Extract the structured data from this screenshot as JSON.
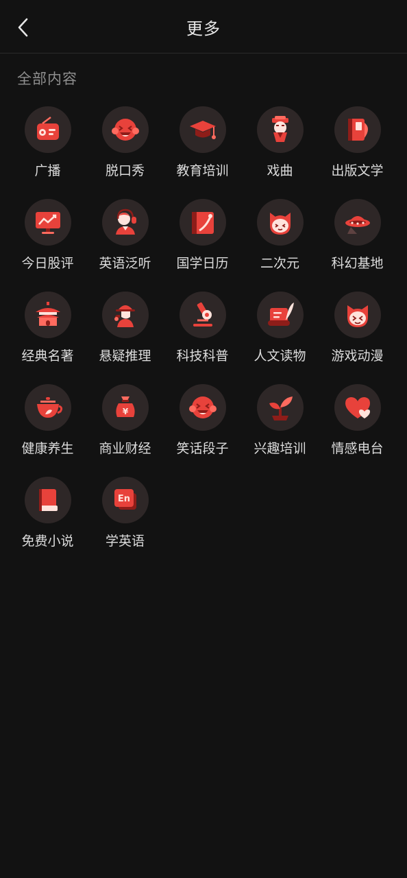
{
  "header": {
    "title": "更多"
  },
  "section": {
    "title": "全部内容"
  },
  "items": [
    {
      "label": "广播",
      "icon": "radio"
    },
    {
      "label": "脱口秀",
      "icon": "laugh"
    },
    {
      "label": "教育培训",
      "icon": "grad-cap"
    },
    {
      "label": "戏曲",
      "icon": "opera"
    },
    {
      "label": "出版文学",
      "icon": "book"
    },
    {
      "label": "今日股评",
      "icon": "chart"
    },
    {
      "label": "英语泛听",
      "icon": "headset"
    },
    {
      "label": "国学日历",
      "icon": "calendar"
    },
    {
      "label": "二次元",
      "icon": "anime"
    },
    {
      "label": "科幻基地",
      "icon": "ufo"
    },
    {
      "label": "经典名著",
      "icon": "temple"
    },
    {
      "label": "悬疑推理",
      "icon": "detective"
    },
    {
      "label": "科技科普",
      "icon": "microscope"
    },
    {
      "label": "人文读物",
      "icon": "scroll"
    },
    {
      "label": "游戏动漫",
      "icon": "cat"
    },
    {
      "label": "健康养生",
      "icon": "teapot"
    },
    {
      "label": "商业财经",
      "icon": "moneybag"
    },
    {
      "label": "笑话段子",
      "icon": "laugh"
    },
    {
      "label": "兴趣培训",
      "icon": "sprout"
    },
    {
      "label": "情感电台",
      "icon": "heart"
    },
    {
      "label": "免费小说",
      "icon": "novel"
    },
    {
      "label": "学英语",
      "icon": "en"
    }
  ],
  "colors": {
    "background": "#121212",
    "accent": "#e8423b",
    "circle": "#2e2727"
  }
}
